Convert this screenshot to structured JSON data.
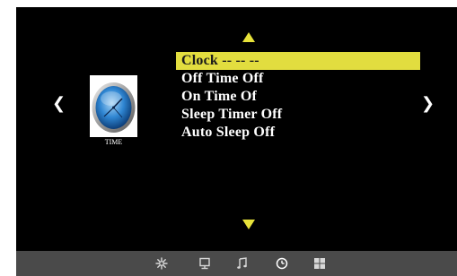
{
  "menu": {
    "items": [
      {
        "label": "Clock -- -- --",
        "selected": true
      },
      {
        "label": "Off  Time  Off",
        "selected": false
      },
      {
        "label": "On  Time  Of",
        "selected": false
      },
      {
        "label": "Sleep  Timer Off",
        "selected": false
      },
      {
        "label": "Auto  Sleep  Off",
        "selected": false
      }
    ]
  },
  "category": {
    "label": "TIME",
    "icon": "clock-icon"
  },
  "nav": {
    "left": "❮",
    "right": "❯"
  },
  "tabs": [
    {
      "icon": "picture-settings-icon",
      "active": false
    },
    {
      "icon": "monitor-icon",
      "active": false
    },
    {
      "icon": "music-note-icon",
      "active": false
    },
    {
      "icon": "clock-icon",
      "active": true
    },
    {
      "icon": "grid-icon",
      "active": false
    }
  ],
  "colors": {
    "highlight": "#e2dd3f",
    "arrow": "#e7e23a",
    "background": "#000000",
    "tabbar": "#4a4a4a"
  }
}
